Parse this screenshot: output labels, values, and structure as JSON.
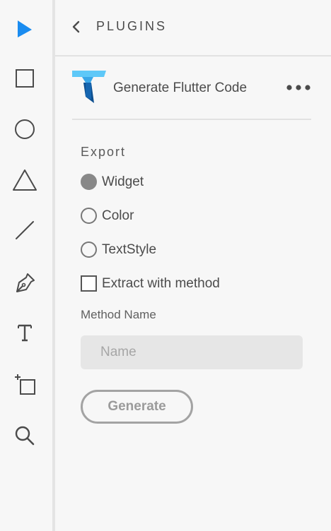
{
  "toolbar": {
    "tools": [
      {
        "name": "select",
        "icon": "arrow-pointer-icon",
        "active": true
      },
      {
        "name": "rectangle",
        "icon": "rectangle-icon"
      },
      {
        "name": "ellipse",
        "icon": "ellipse-icon"
      },
      {
        "name": "polygon",
        "icon": "triangle-icon"
      },
      {
        "name": "line",
        "icon": "line-icon"
      },
      {
        "name": "pen",
        "icon": "pen-icon"
      },
      {
        "name": "text",
        "icon": "text-icon"
      },
      {
        "name": "artboard",
        "icon": "artboard-icon"
      },
      {
        "name": "zoom",
        "icon": "magnifier-icon"
      }
    ]
  },
  "panel": {
    "title": "PLUGINS",
    "back_icon": "chevron-left-icon"
  },
  "plugin": {
    "name": "Generate Flutter Code",
    "logo_icon": "flutter-logo-icon",
    "more_icon": "ellipsis-icon"
  },
  "export": {
    "label": "Export",
    "options": [
      {
        "label": "Widget",
        "selected": true
      },
      {
        "label": "Color",
        "selected": false
      },
      {
        "label": "TextStyle",
        "selected": false
      }
    ],
    "extract_label": "Extract with method",
    "extract_checked": false
  },
  "method": {
    "label": "Method Name",
    "placeholder": "Name",
    "value": ""
  },
  "actions": {
    "generate_label": "Generate"
  },
  "colors": {
    "accent": "#1a8cf0",
    "icon": "#4b4b4b",
    "selected_radio": "#888888"
  }
}
